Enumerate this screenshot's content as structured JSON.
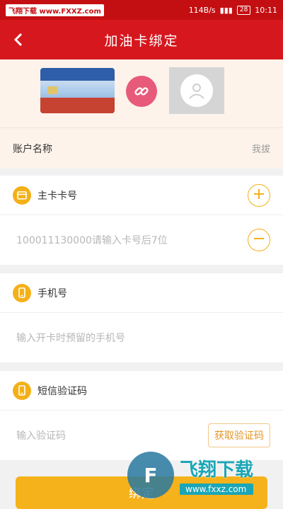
{
  "status_bar": {
    "watermark_badge": "飞翔下载 www.FXXZ.com",
    "net_speed": "114B/s",
    "battery": "28",
    "time": "10:11"
  },
  "header": {
    "title": "加油卡绑定"
  },
  "account": {
    "label": "账户名称",
    "value": "我拔"
  },
  "main_card": {
    "title": "主卡卡号",
    "input_placeholder": "100011130000请输入卡号后7位"
  },
  "phone": {
    "title": "手机号",
    "input_placeholder": "输入开卡时预留的手机号"
  },
  "sms": {
    "title": "短信验证码",
    "input_placeholder": "输入验证码",
    "get_code_label": "获取验证码"
  },
  "submit": {
    "label": "绑定"
  },
  "watermark": {
    "main": "飞翔下载",
    "sub": "www.fxxz.com"
  },
  "icons": {
    "back": "chevron-left-icon",
    "link": "link-icon",
    "user": "user-icon",
    "card": "card-icon",
    "phone": "phone-icon",
    "add": "plus-icon",
    "remove": "minus-icon"
  },
  "colors": {
    "header_bg": "#d7171e",
    "accent_yellow": "#f4b018",
    "link_pink": "#e85a7a",
    "card_area_bg": "#fdf3ea"
  }
}
